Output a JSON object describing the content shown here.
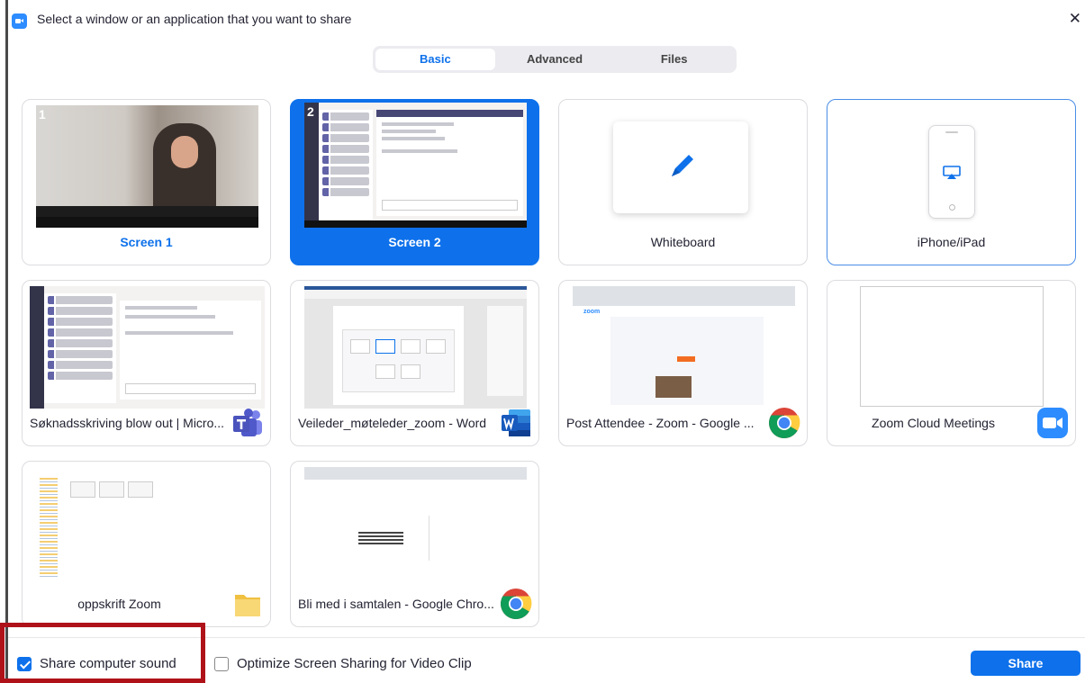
{
  "window": {
    "title": "Select a window or an application that you want to share",
    "close_symbol": "✕"
  },
  "tabs": [
    {
      "label": "Basic",
      "active": true
    },
    {
      "label": "Advanced",
      "active": false
    },
    {
      "label": "Files",
      "active": false
    }
  ],
  "tiles": [
    {
      "label": "Screen 1",
      "screen_number": "1",
      "selected": false,
      "icon": null
    },
    {
      "label": "Screen 2",
      "screen_number": "2",
      "selected": true,
      "icon": null
    },
    {
      "label": "Whiteboard",
      "selected": false,
      "icon": "pencil-icon"
    },
    {
      "label": "iPhone/iPad",
      "selected": false,
      "icon": "airplay-icon"
    },
    {
      "label": "Søknadsskriving blow out | Micro...",
      "selected": false,
      "icon": "teams-icon"
    },
    {
      "label": "Veileder_møteleder_zoom - Word",
      "selected": false,
      "icon": "word-icon"
    },
    {
      "label": "Post Attendee - Zoom - Google ...",
      "selected": false,
      "icon": "chrome-icon"
    },
    {
      "label": "Zoom Cloud Meetings",
      "selected": false,
      "icon": "zoom-icon"
    },
    {
      "label": "oppskrift Zoom",
      "selected": false,
      "icon": "folder-icon"
    },
    {
      "label": "Bli med i samtalen - Google Chro...",
      "selected": false,
      "icon": "chrome-icon"
    }
  ],
  "options": {
    "share_sound": {
      "label": "Share computer sound",
      "checked": true
    },
    "optimize_video": {
      "label": "Optimize Screen Sharing for Video Clip",
      "checked": false
    }
  },
  "share_button": {
    "label": "Share"
  },
  "thumb_text": {
    "zoom_brand": "zoom"
  },
  "colors": {
    "accent": "#0E71EB",
    "highlight": "#b0121a"
  }
}
